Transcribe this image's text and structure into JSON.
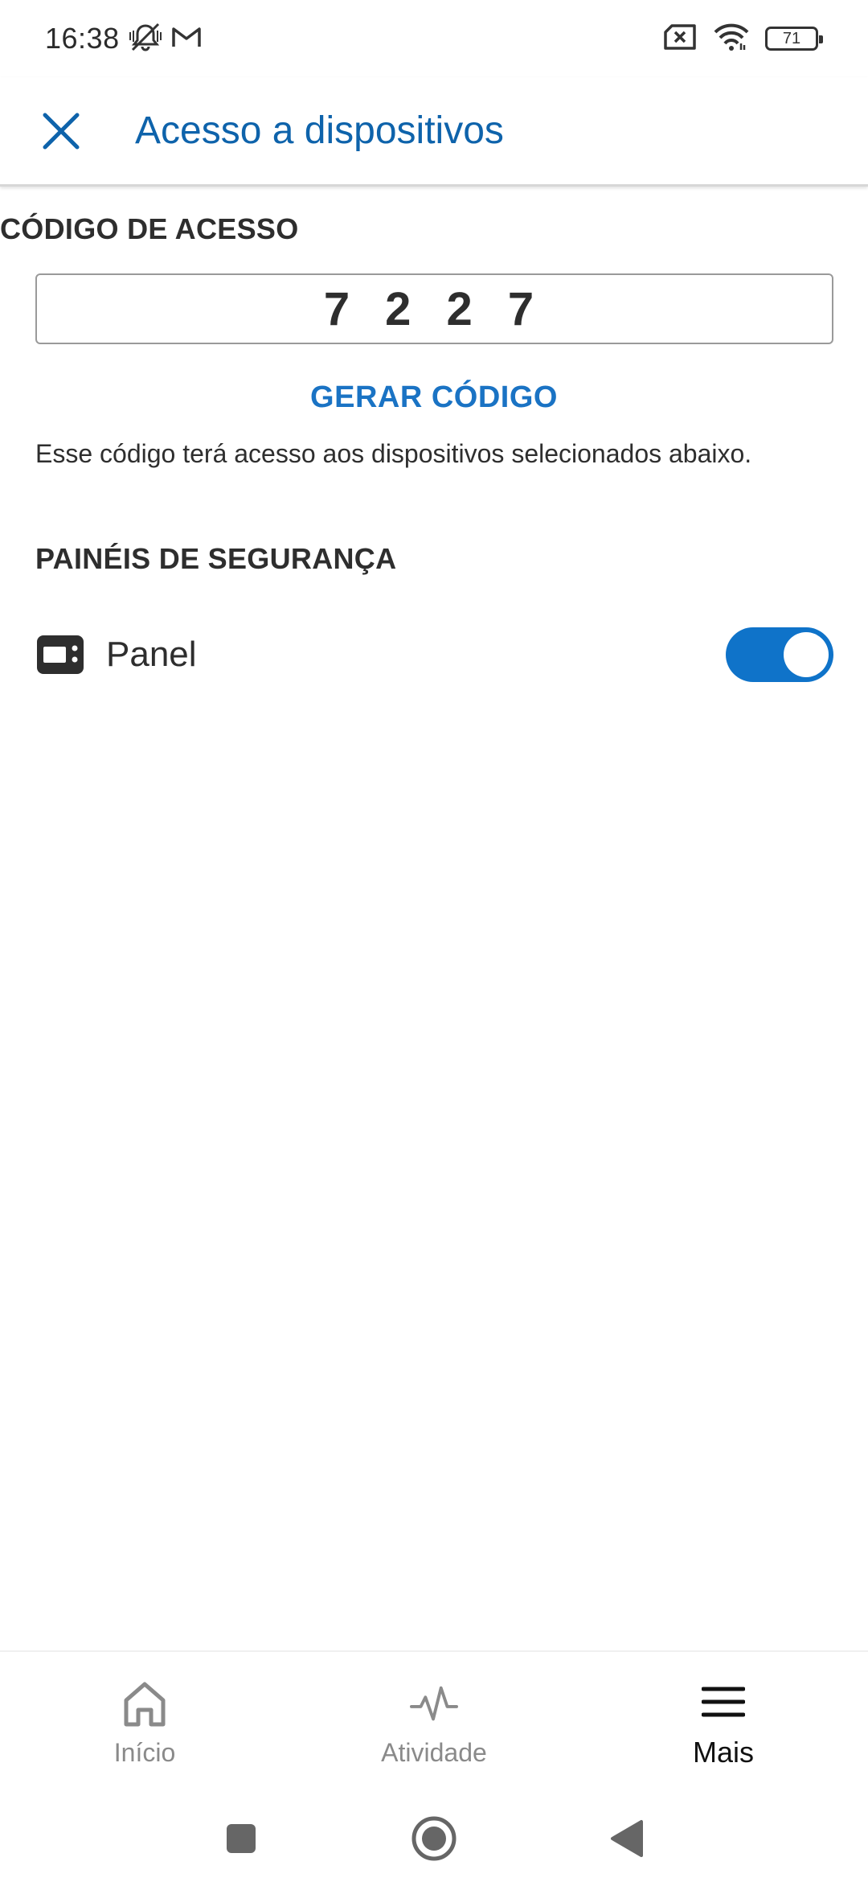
{
  "status_bar": {
    "time": "16:38",
    "battery": "71",
    "icons": [
      "mute-bell-icon",
      "gmail-icon",
      "no-sim-icon",
      "wifi-icon",
      "battery-icon"
    ]
  },
  "app_bar": {
    "title": "Acesso a dispositivos",
    "close_icon": "close-icon"
  },
  "access_code": {
    "section_title": "CÓDIGO DE ACESSO",
    "value": "7 2 2 7",
    "generate_label": "GERAR CÓDIGO",
    "helper_text": "Esse código terá acesso aos dispositivos selecionados abaixo."
  },
  "security_panels": {
    "section_title": "PAINÉIS DE SEGURANÇA",
    "items": [
      {
        "label": "Panel",
        "icon": "panel-device-icon",
        "enabled": true
      }
    ]
  },
  "bottom_nav": {
    "items": [
      {
        "label": "Início",
        "icon": "home-icon",
        "active": false
      },
      {
        "label": "Atividade",
        "icon": "activity-icon",
        "active": false
      },
      {
        "label": "Mais",
        "icon": "menu-icon",
        "active": true
      }
    ]
  },
  "colors": {
    "primary": "#0e63ab",
    "accent": "#1a73c4",
    "toggle_on": "#0f73c9"
  }
}
